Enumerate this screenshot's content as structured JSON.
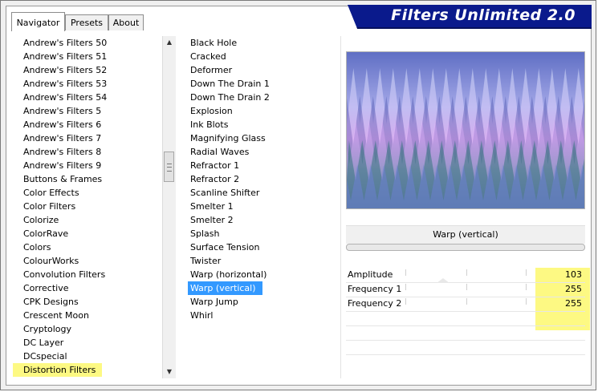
{
  "app": {
    "title": "Filters Unlimited 2.0"
  },
  "tabs": [
    {
      "label": "Navigator",
      "active": true
    },
    {
      "label": "Presets",
      "active": false
    },
    {
      "label": "About",
      "active": false
    }
  ],
  "categories": [
    "Andrew's Filters 50",
    "Andrew's Filters 51",
    "Andrew's Filters 52",
    "Andrew's Filters 53",
    "Andrew's Filters 54",
    "Andrew's Filters 5",
    "Andrew's Filters 6",
    "Andrew's Filters 7",
    "Andrew's Filters 8",
    "Andrew's Filters 9",
    "Buttons & Frames",
    "Color Effects",
    "Color Filters",
    "Colorize",
    "ColorRave",
    "Colors",
    "ColourWorks",
    "Convolution Filters",
    "Corrective",
    "CPK Designs",
    "Crescent Moon",
    "Cryptology",
    "DC Layer",
    "DCspecial",
    "Distortion Filters"
  ],
  "selected_category": "Distortion Filters",
  "filters": [
    "Black Hole",
    "Cracked",
    "Deformer",
    "Down The Drain 1",
    "Down The Drain 2",
    "Explosion",
    "Ink Blots",
    "Magnifying Glass",
    "Radial Waves",
    "Refractor 1",
    "Refractor 2",
    "Scanline Shifter",
    "Smelter 1",
    "Smelter 2",
    "Splash",
    "Surface Tension",
    "Twister",
    "Warp (horizontal)",
    "Warp (vertical)",
    "Warp Jump",
    "Whirl"
  ],
  "selected_filter": "Warp (vertical)",
  "filter_title": "Warp (vertical)",
  "parameters": [
    {
      "name": "Amplitude",
      "value": "103"
    },
    {
      "name": "Frequency 1",
      "value": "255"
    },
    {
      "name": "Frequency 2",
      "value": "255"
    }
  ],
  "colors": {
    "banner": "#0a1a8c",
    "highlight": "#fdf983",
    "selection": "#3399ff"
  },
  "icons": {
    "scroll_up": "triangle-up",
    "scroll_down": "triangle-down"
  }
}
